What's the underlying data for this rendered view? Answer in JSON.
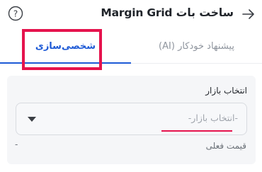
{
  "header": {
    "title": "ساخت بات Margin Grid"
  },
  "icons": {
    "back": "arrow-right-icon",
    "help": "question-circle-icon",
    "caret": "caret-down-icon"
  },
  "tabs": [
    {
      "label": "پیشنهاد خودکار (AI)",
      "active": false
    },
    {
      "label": "شخصی‌سازی",
      "active": true
    }
  ],
  "form": {
    "market_label": "انتخاب بازار",
    "market_placeholder": "-انتخاب بازار-",
    "price_label": "قیمت فعلی",
    "price_value": "-"
  },
  "colors": {
    "accent": "#1e5ad6",
    "annotation": "#e5134d",
    "panel_bg": "#f5f6f8"
  }
}
